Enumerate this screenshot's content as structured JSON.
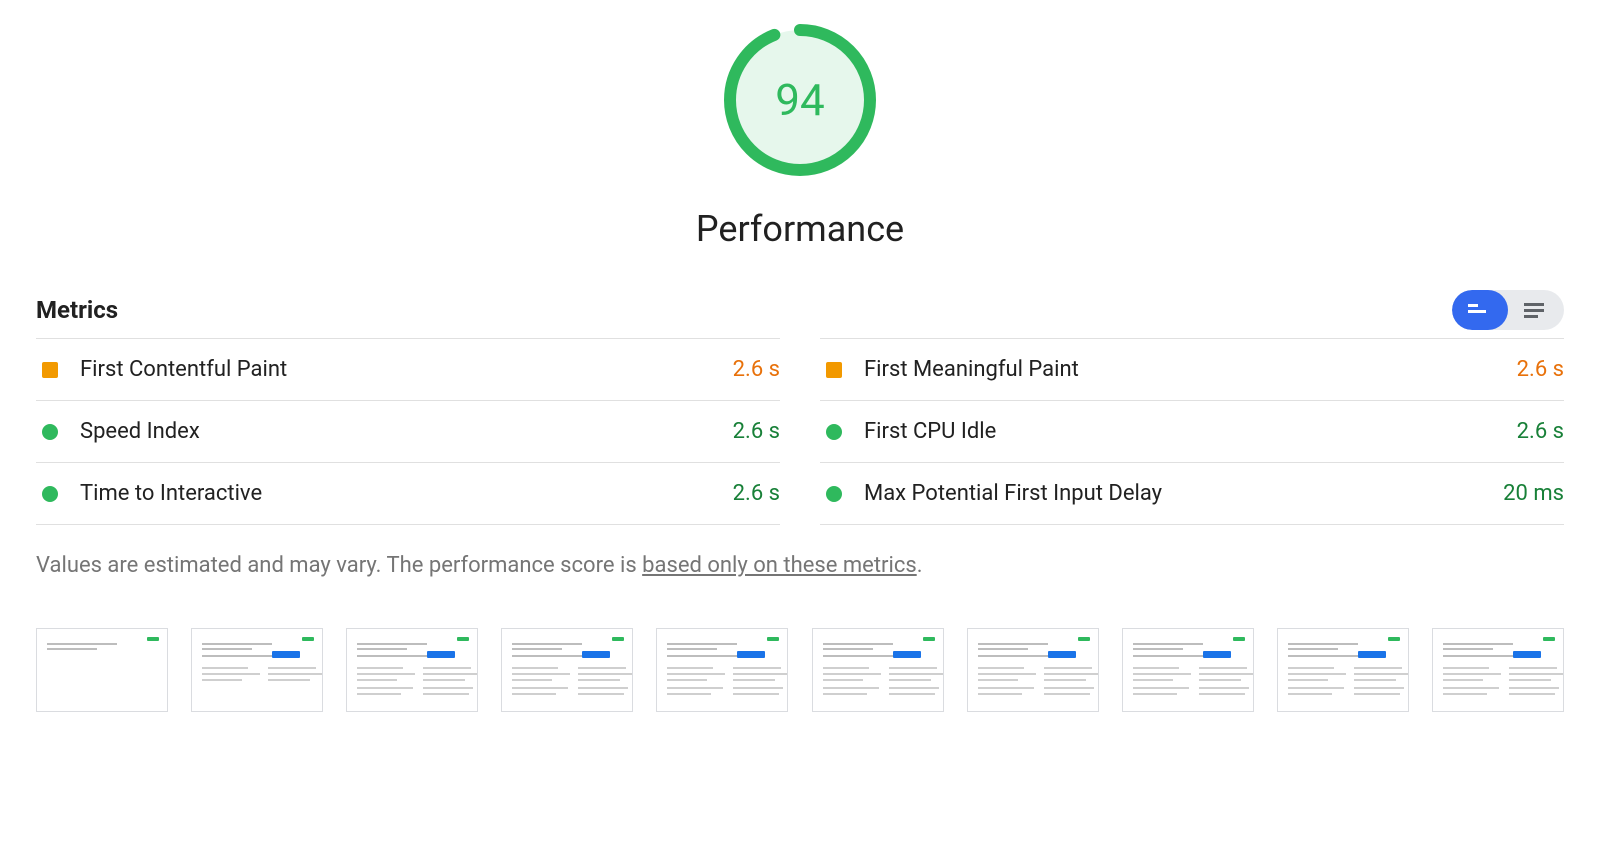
{
  "score": {
    "value": "94",
    "percent": 94,
    "color": "#2fb95d",
    "bgTint": "#e6f7ec"
  },
  "category_title": "Performance",
  "metrics_heading": "Metrics",
  "metrics": [
    {
      "label": "First Contentful Paint",
      "value": "2.6 s",
      "status": "orange"
    },
    {
      "label": "First Meaningful Paint",
      "value": "2.6 s",
      "status": "orange"
    },
    {
      "label": "Speed Index",
      "value": "2.6 s",
      "status": "green"
    },
    {
      "label": "First CPU Idle",
      "value": "2.6 s",
      "status": "green"
    },
    {
      "label": "Time to Interactive",
      "value": "2.6 s",
      "status": "green"
    },
    {
      "label": "Max Potential First Input Delay",
      "value": "20 ms",
      "status": "green"
    }
  ],
  "disclaimer": {
    "prefix": "Values are estimated and may vary. The performance score is ",
    "link": "based only on these metrics",
    "suffix": "."
  },
  "filmstrip_frame_count": 10,
  "view_toggle": {
    "active": "summary",
    "options": [
      "summary",
      "detail"
    ]
  }
}
